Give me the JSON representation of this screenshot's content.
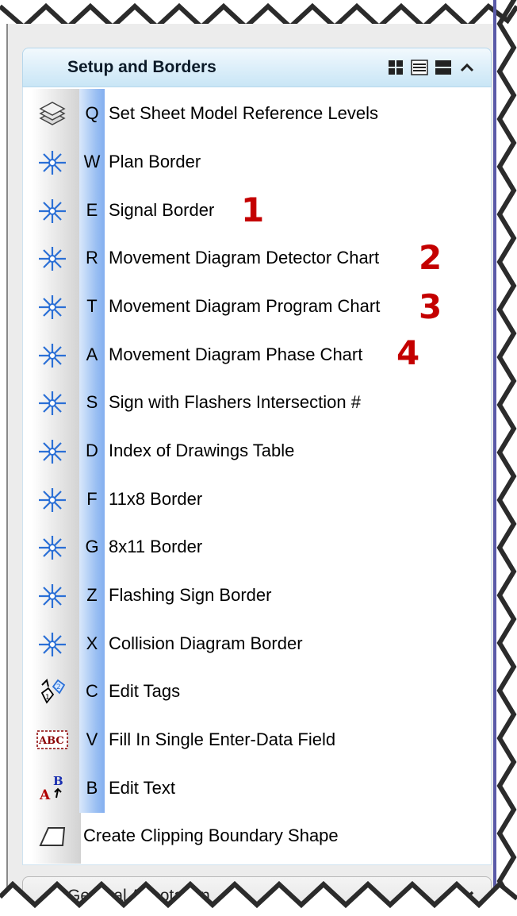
{
  "panel": {
    "section_title": "Setup and Borders",
    "collapsed_section_title": "General Annotation"
  },
  "view_buttons": [
    {
      "icon": "grid-view-icon"
    },
    {
      "icon": "list-view-icon"
    },
    {
      "icon": "large-icon-view-icon"
    },
    {
      "icon": "chevron-up-icon"
    }
  ],
  "items": [
    {
      "key": "Q",
      "label": "Set Sheet Model Reference Levels",
      "icon": "reference-levels-icon"
    },
    {
      "key": "W",
      "label": "Plan Border",
      "icon": "cell-placement-icon"
    },
    {
      "key": "E",
      "label": "Signal Border",
      "icon": "cell-placement-icon"
    },
    {
      "key": "R",
      "label": "Movement Diagram Detector Chart",
      "icon": "cell-placement-icon"
    },
    {
      "key": "T",
      "label": "Movement Diagram  Program Chart",
      "icon": "cell-placement-icon"
    },
    {
      "key": "A",
      "label": "Movement Diagram  Phase Chart",
      "icon": "cell-placement-icon"
    },
    {
      "key": "S",
      "label": "Sign with Flashers Intersection #",
      "icon": "cell-placement-icon"
    },
    {
      "key": "D",
      "label": "Index of Drawings Table",
      "icon": "cell-placement-icon"
    },
    {
      "key": "F",
      "label": "11x8 Border",
      "icon": "cell-placement-icon"
    },
    {
      "key": "G",
      "label": "8x11 Border",
      "icon": "cell-placement-icon"
    },
    {
      "key": "Z",
      "label": "Flashing Sign Border",
      "icon": "cell-placement-icon"
    },
    {
      "key": "X",
      "label": "Collision Diagram Border",
      "icon": "cell-placement-icon"
    },
    {
      "key": "C",
      "label": "Edit Tags",
      "icon": "edit-tags-icon"
    },
    {
      "key": "V",
      "label": "Fill In Single Enter-Data Field",
      "icon": "enter-data-field-icon",
      "icon_text": "ABC"
    },
    {
      "key": "B",
      "label": "Edit Text",
      "icon": "edit-text-icon",
      "icon_text_a": "A",
      "icon_text_b": "B"
    },
    {
      "key": "",
      "label": "Create Clipping Boundary Shape",
      "icon": "clip-boundary-icon"
    }
  ],
  "annotations": [
    {
      "text": "1",
      "item_index": 2,
      "color": "#c40000"
    },
    {
      "text": "2",
      "item_index": 3,
      "color": "#c40000"
    },
    {
      "text": "3",
      "item_index": 4,
      "color": "#c40000"
    },
    {
      "text": "4",
      "item_index": 5,
      "color": "#c40000"
    }
  ],
  "colors": {
    "header_gradient": "#c9e6f6",
    "key_column": "#97bdf2",
    "icon_blue": "#2a6fd6",
    "annotation_red": "#c40000"
  }
}
